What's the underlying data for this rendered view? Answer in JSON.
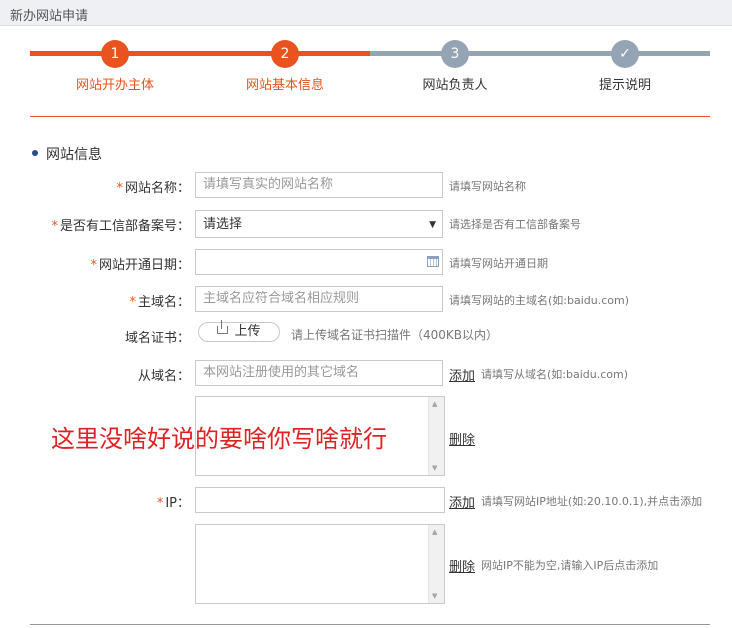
{
  "header": {
    "title": "新办网站申请"
  },
  "steps": [
    {
      "number": "1",
      "label": "网站开办主体",
      "state": "completed"
    },
    {
      "number": "2",
      "label": "网站基本信息",
      "state": "current"
    },
    {
      "number": "3",
      "label": "网站负责人",
      "state": "pending"
    },
    {
      "number": "✓",
      "label": "提示说明",
      "state": "pending"
    }
  ],
  "colors": {
    "accent": "#e8531f",
    "inactive": "#95a4b5",
    "required": "#e8531f",
    "overlay_text": "#e02222"
  },
  "section": {
    "title": "网站信息"
  },
  "form": {
    "site_name": {
      "label": "网站名称：",
      "required": true,
      "placeholder": "请填写真实的网站名称",
      "hint": "请填写网站名称"
    },
    "icp_record": {
      "label": "是否有工信部备案号：",
      "required": true,
      "value": "请选择",
      "hint": "请选择是否有工信部备案号"
    },
    "open_date": {
      "label": "网站开通日期：",
      "required": true,
      "value": "",
      "hint": "请填写网站开通日期",
      "icon": "calendar-icon"
    },
    "main_domain": {
      "label": "主域名：",
      "required": true,
      "placeholder": "主域名应符合域名相应规则",
      "hint": "请填写网站的主域名(如:baidu.com)"
    },
    "cert": {
      "label": "域名证书：",
      "required": false,
      "button": "上传",
      "icon": "upload-icon",
      "hint": "请上传域名证书扫描件（400KB以内）"
    },
    "sub_domain": {
      "label": "从域名：",
      "required": false,
      "placeholder": "本网站注册使用的其它域名",
      "add_link": "添加",
      "hint": "请填写从域名(如:baidu.com)",
      "delete_link": "删除"
    },
    "ip": {
      "label": "IP：",
      "required": true,
      "value": "",
      "add_link": "添加",
      "hint": "请填写网站IP地址(如:20.10.0.1),并点击添加",
      "delete_link": "删除",
      "delete_hint": "网站IP不能为空,请输入IP后点击添加"
    }
  },
  "overlay": {
    "text": "这里没啥好说的要啥你写啥就行"
  }
}
